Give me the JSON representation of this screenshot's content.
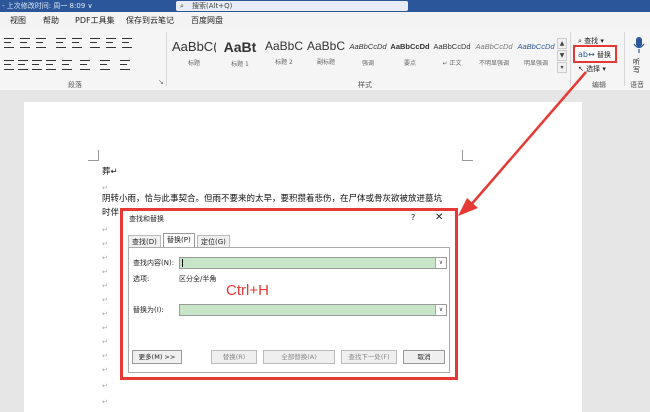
{
  "titlebar": {
    "text": "- 上次修改时间: 周一 8:09 ∨",
    "search": "搜索(Alt+Q)"
  },
  "menu": [
    "视图",
    "帮助",
    "PDF工具集",
    "保存到云笔记",
    "百度网盘"
  ],
  "ribbon": {
    "groups": {
      "paragraph": "段落",
      "styles": "样式",
      "editing": "编辑",
      "voice": "语音"
    },
    "styles": [
      {
        "preview": "AaBbC(",
        "name": "标题"
      },
      {
        "preview": "AaBt",
        "name": "标题 1"
      },
      {
        "preview": "AaBbC",
        "name": "标题 2"
      },
      {
        "preview": "AaBbC",
        "name": "副标题"
      },
      {
        "preview": "AaBbCcDd",
        "name": "强调"
      },
      {
        "preview": "AaBbCcDd",
        "name": "要点"
      },
      {
        "preview": "AaBbCcDd",
        "name": "↵ 正文"
      },
      {
        "preview": "AaBbCcDd",
        "name": "不明显强调"
      },
      {
        "preview": "AaBbCcDd",
        "name": "明显强调"
      }
    ],
    "edit": {
      "find": "查找",
      "replace": "替换",
      "select": "选择"
    },
    "voice_btn": "听写"
  },
  "document": {
    "line1": "葬↵",
    "line2": "阴转小雨，恰与此事契合。但雨不要来的太早，要积攒着悲伤，在尸体或骨灰欲被放进墓坑",
    "line3": "时伴",
    "mark": "↵"
  },
  "dialog": {
    "title": "查找和替换",
    "help": "?",
    "close": "✕",
    "tabs": [
      "查找(D)",
      "替换(P)",
      "定位(G)"
    ],
    "find_label": "查找内容(N):",
    "options_label": "选项:",
    "options_value": "区分全/半角",
    "replace_label": "替换为(I):",
    "buttons": {
      "more": "更多(M) >>",
      "replace": "替换(R)",
      "replace_all": "全部替换(A)",
      "find_next": "查找下一处(F)",
      "cancel": "取消"
    },
    "annotation": "Ctrl+H"
  },
  "colors": {
    "accent": "#2b579a",
    "highlight": "#e53935",
    "field": "#c7e6c7"
  }
}
